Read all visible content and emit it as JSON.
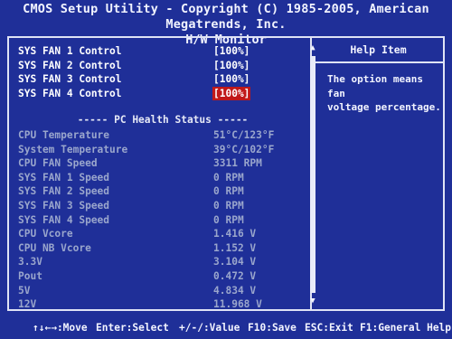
{
  "header": {
    "title": "CMOS Setup Utility - Copyright (C) 1985-2005, American Megatrends, Inc.",
    "subtitle": "H/W Monitor"
  },
  "fan_controls": [
    {
      "label": "SYS FAN 1 Control",
      "value": "[100%]",
      "selected": false
    },
    {
      "label": "SYS FAN 2 Control",
      "value": "[100%]",
      "selected": false
    },
    {
      "label": "SYS FAN 3 Control",
      "value": "[100%]",
      "selected": false
    },
    {
      "label": "SYS FAN 4 Control",
      "value": "[100%]",
      "selected": true
    }
  ],
  "section_title": "----- PC Health Status -----",
  "health": [
    {
      "label": "CPU Temperature",
      "value": "51°C/123°F"
    },
    {
      "label": "System Temperature",
      "value": "39°C/102°F"
    },
    {
      "label": "CPU FAN Speed",
      "value": "3311 RPM"
    },
    {
      "label": "SYS FAN 1 Speed",
      "value": "0 RPM"
    },
    {
      "label": "SYS FAN 2 Speed",
      "value": "0 RPM"
    },
    {
      "label": "SYS FAN 3 Speed",
      "value": "0 RPM"
    },
    {
      "label": "SYS FAN 4 Speed",
      "value": "0 RPM"
    },
    {
      "label": "CPU Vcore",
      "value": "1.416 V"
    },
    {
      "label": "CPU NB Vcore",
      "value": "1.152 V"
    },
    {
      "label": "3.3V",
      "value": "3.104 V"
    },
    {
      "label": "Pout",
      "value": "0.472 V"
    },
    {
      "label": "5V",
      "value": "4.834 V"
    },
    {
      "label": "12V",
      "value": "11.968 V"
    }
  ],
  "help": {
    "title": "Help Item",
    "text": "The option means fan\nvoltage percentage."
  },
  "scrollbar": {
    "up": "▲",
    "down": "▼"
  },
  "footer": {
    "move": "↑↓←→:Move",
    "select": "Enter:Select",
    "value": "+/-/:Value",
    "save": "F10:Save",
    "exit": "ESC:Exit",
    "help": "F1:General Help"
  }
}
